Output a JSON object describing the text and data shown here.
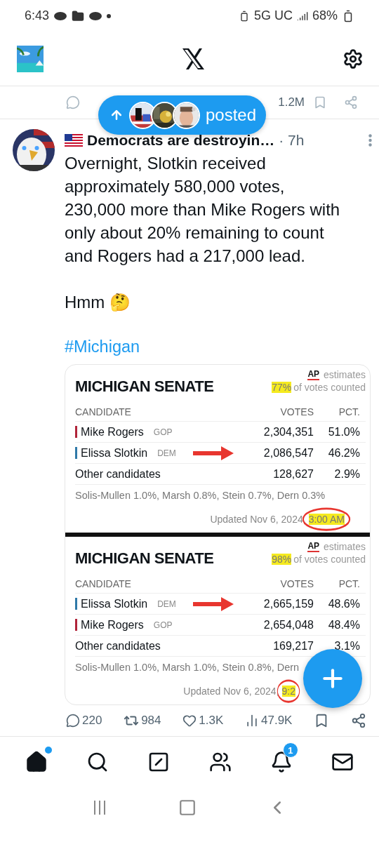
{
  "status_bar": {
    "time": "6:43",
    "network": "5G UC",
    "battery": "68%"
  },
  "previous_tweet": {
    "views": "1.2M"
  },
  "new_posts_pill": {
    "label": "posted"
  },
  "tweet": {
    "author": "Democrats are destroyin…",
    "meta": "· 7h",
    "paragraphs": [
      "Overnight, Slotkin received approximately 580,000 votes, 230,000 more than Mike Rogers with only about 20% remaining to count and Rogers had a 217,000 lead.",
      "Hmm 🤔"
    ],
    "hashtag": "#Michigan",
    "image": {
      "tables": [
        {
          "title": "MICHIGAN SENATE",
          "source": "AP",
          "estimates": "estimates",
          "counted_pct": "77%",
          "counted_text": "of votes counted",
          "columns": [
            "CANDIDATE",
            "VOTES",
            "PCT."
          ],
          "rows": [
            {
              "kind": "candidate",
              "name": "Mike Rogers",
              "party": "GOP",
              "color": "#b0243a",
              "votes": "2,304,351",
              "pct": "51.0%",
              "arrow": false
            },
            {
              "kind": "candidate",
              "name": "Elissa Slotkin",
              "party": "DEM",
              "color": "#2f79a8",
              "votes": "2,086,547",
              "pct": "46.2%",
              "arrow": true
            },
            {
              "kind": "other",
              "name": "Other candidates",
              "votes": "128,627",
              "pct": "2.9%",
              "arrow": false
            }
          ],
          "others": "Solis-Mullen 1.0%, Marsh 0.8%, Stein 0.7%, Dern 0.3%",
          "updated": "Updated Nov 6, 2024,",
          "updated_time": "3:00 AM",
          "circled": true
        },
        {
          "title": "MICHIGAN SENATE",
          "source": "AP",
          "estimates": "estimates",
          "counted_pct": "98%",
          "counted_text": "of votes counted",
          "columns": [
            "CANDIDATE",
            "VOTES",
            "PCT."
          ],
          "rows": [
            {
              "kind": "candidate",
              "name": "Elissa Slotkin",
              "party": "DEM",
              "color": "#2f79a8",
              "votes": "2,665,159",
              "pct": "48.6%",
              "arrow": true
            },
            {
              "kind": "candidate",
              "name": "Mike Rogers",
              "party": "GOP",
              "color": "#b0243a",
              "votes": "2,654,048",
              "pct": "48.4%",
              "arrow": false
            },
            {
              "kind": "other",
              "name": "Other candidates",
              "votes": "169,217",
              "pct": "3.1%",
              "arrow": false
            }
          ],
          "others": "Solis-Mullen 1.0%, Marsh 1.0%, Stein 0.8%, Dern",
          "updated": "Updated Nov 6, 2024,",
          "updated_time": "9:2",
          "circled": true
        }
      ]
    },
    "stats": {
      "replies": "220",
      "reposts": "984",
      "likes": "1.3K",
      "views": "47.9K"
    }
  },
  "nav": [
    {
      "kind": "home",
      "selected": true,
      "dot": true
    },
    {
      "kind": "search",
      "selected": false,
      "dot": false
    },
    {
      "kind": "grok",
      "selected": false,
      "dot": false
    },
    {
      "kind": "communities",
      "selected": false,
      "dot": false
    },
    {
      "kind": "notifications",
      "selected": false,
      "dot": false,
      "badge": "1"
    },
    {
      "kind": "messages",
      "selected": false,
      "dot": false
    }
  ]
}
